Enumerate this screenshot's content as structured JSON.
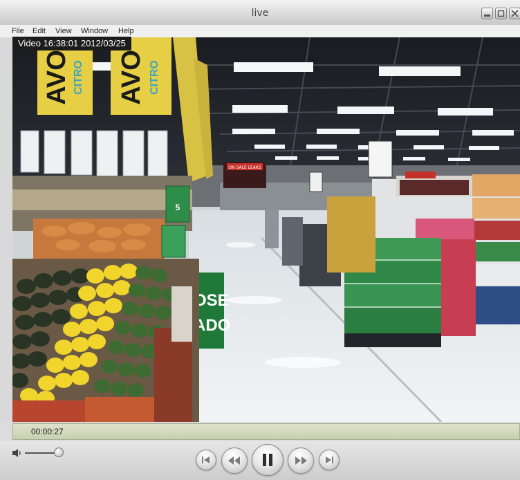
{
  "window": {
    "title": "live"
  },
  "menu": {
    "items": [
      "File",
      "Edit",
      "View",
      "Window",
      "Help"
    ]
  },
  "video": {
    "overlay_text": "Video 16:38:01 2012/03/25",
    "signs": {
      "avo_left_1": "AVO",
      "avo_left_2": "CITRO",
      "avo_right_1": "AVO",
      "avo_right_2": "CITRO",
      "green_sign_1": "OSE",
      "green_sign_2": "ADO",
      "price_sign": "5",
      "banner": "ON SALE LEAKS"
    }
  },
  "status": {
    "elapsed": "00:00:27"
  },
  "controls": {
    "buttons": [
      "skip-back",
      "rewind",
      "pause",
      "fast-forward",
      "skip-forward"
    ]
  },
  "colors": {
    "osd_bg": "#1c1c1c",
    "status_bg": "#d6dbbd",
    "sign_yellow": "#e8d24a",
    "sign_green": "#1f7a3a"
  }
}
